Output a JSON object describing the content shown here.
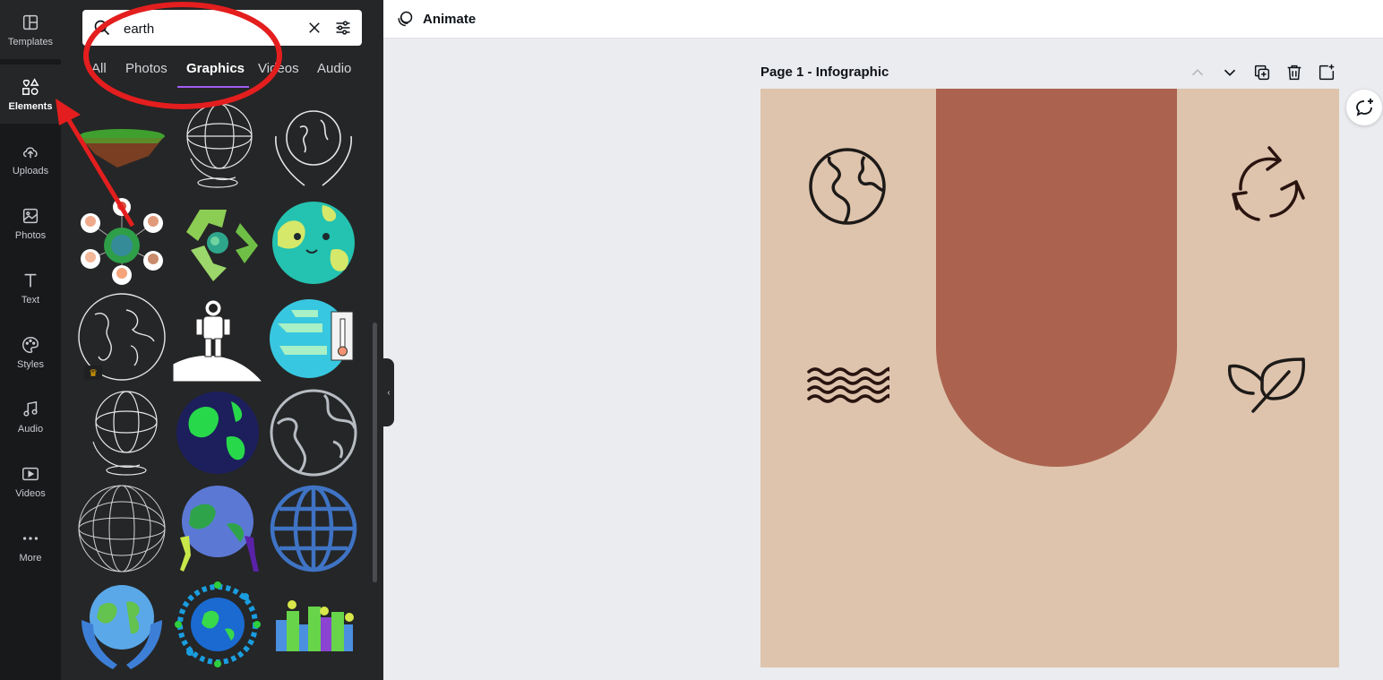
{
  "rail": {
    "items": [
      {
        "label": "Templates"
      },
      {
        "label": "Elements"
      },
      {
        "label": "Uploads"
      },
      {
        "label": "Photos"
      },
      {
        "label": "Text"
      },
      {
        "label": "Styles"
      },
      {
        "label": "Audio"
      },
      {
        "label": "Videos"
      },
      {
        "label": "More"
      }
    ],
    "active": "Elements"
  },
  "search": {
    "value": "earth"
  },
  "tabs": [
    {
      "label": "All"
    },
    {
      "label": "Photos"
    },
    {
      "label": "Graphics"
    },
    {
      "label": "Videos"
    },
    {
      "label": "Audio"
    }
  ],
  "active_tab": "Graphics",
  "graphics": [
    "floating-island",
    "wireframe-globe-stand",
    "earth-in-hands-outline",
    "people-network-earth",
    "recycle-earth",
    "smiling-earth",
    "world-map-outline",
    "astronaut-on-moon",
    "earth-thermometer",
    "wireframe-globe-stand",
    "green-earth-navy",
    "earth-outline-circle",
    "wireframe-sphere",
    "people-carrying-earth",
    "blue-globe-grid",
    "earth-in-blue-hands",
    "people-around-earth",
    "green-city"
  ],
  "topbar": {
    "animate_label": "Animate"
  },
  "page": {
    "title": "Page 1 - Infographic"
  },
  "canvas": {
    "background": "#dec4ad",
    "arch_color": "#ab634f",
    "icons": [
      "earth-icon",
      "recycle-icon",
      "water-waves-icon",
      "leaf-icon"
    ]
  },
  "annotations": {
    "circle_color": "#e41e1e",
    "arrow_color": "#e41e1e"
  }
}
